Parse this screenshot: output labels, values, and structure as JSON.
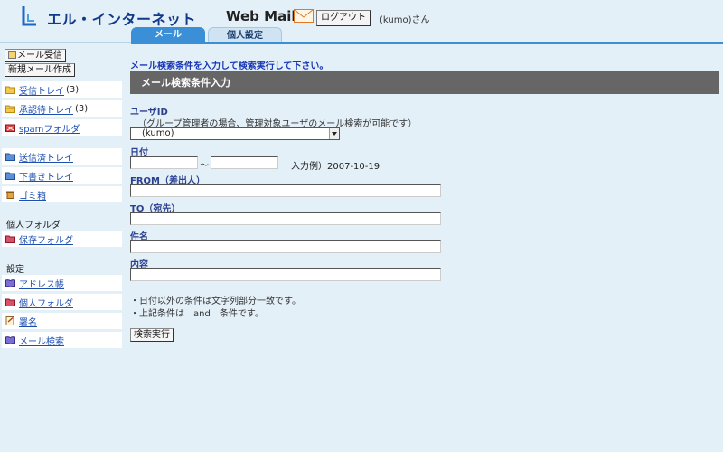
{
  "header": {
    "brand": "エル・インターネット",
    "webmail": "Web Mail",
    "logout_label": "ログアウト",
    "user": "(kumo)さん",
    "tabs": [
      {
        "label": "メール",
        "active": true
      },
      {
        "label": "個人設定",
        "active": false
      }
    ]
  },
  "sidebar": {
    "receive_label": "メール受信",
    "compose_label": "新規メール作成",
    "folders": [
      {
        "label": "受信トレイ",
        "count": "(3)",
        "icon": "folder-icon"
      },
      {
        "label": "承認待トレイ",
        "count": "(3)",
        "icon": "folder-open-icon"
      },
      {
        "label": "spamフォルダ",
        "count": "",
        "icon": "spam-folder-icon"
      }
    ],
    "system_folders": [
      {
        "label": "送信済トレイ",
        "icon": "folder-icon"
      },
      {
        "label": "下書きトレイ",
        "icon": "folder-icon"
      },
      {
        "label": "ゴミ箱",
        "icon": "trash-icon"
      }
    ],
    "personal_heading": "個人フォルダ",
    "personal_folders": [
      {
        "label": "保存フォルダ",
        "icon": "folder-icon"
      }
    ],
    "settings_heading": "設定",
    "settings_items": [
      {
        "label": "アドレス帳",
        "icon": "address-book-icon"
      },
      {
        "label": "個人フォルダ",
        "icon": "folder-icon"
      },
      {
        "label": "署名",
        "icon": "signature-icon"
      },
      {
        "label": "メール検索",
        "icon": "search-book-icon"
      }
    ]
  },
  "main": {
    "instruction": "メール検索条件を入力して検索実行して下さい。",
    "section_title": "メール検索条件入力",
    "user_id_label": "ユーザID",
    "user_id_note": "（グループ管理者の場合、管理対象ユーザのメール検索が可能です）",
    "user_id_value": "(kumo)",
    "date_label": "日付",
    "date_from": "",
    "date_to": "",
    "date_separator": "〜",
    "date_example": "入力例）2007-10-19",
    "from_label": "FROM（差出人）",
    "from_value": "",
    "to_label": "TO（宛先）",
    "to_value": "",
    "subject_label": "件名",
    "subject_value": "",
    "body_label": "内容",
    "body_value": "",
    "notes": [
      "・日付以外の条件は文字列部分一致です。",
      "・上記条件は　and　条件です。"
    ],
    "search_button": "検索実行"
  },
  "colors": {
    "accent": "#3b8fd6",
    "link": "#1d4fb3",
    "label": "#2a3f8f",
    "bar": "#666666",
    "background": "#e4f0f8"
  }
}
